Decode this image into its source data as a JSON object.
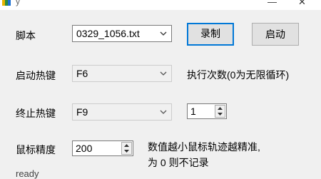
{
  "window": {
    "title": "y",
    "minimize_glyph": "—",
    "close_glyph": "✕"
  },
  "row_script": {
    "label": "脚本",
    "selected": "0329_1056.txt",
    "record_label": "录制",
    "start_label": "启动"
  },
  "row_start_hotkey": {
    "label": "启动热键",
    "selected": "F6",
    "repeat_hint": "执行次数(0为无限循环)"
  },
  "row_stop_hotkey": {
    "label": "终止热键",
    "selected": "F9",
    "repeat_count": "1"
  },
  "row_mouse_precision": {
    "label": "鼠标精度",
    "value": "200",
    "hint_line1": "数值越小鼠标轨迹越精准,",
    "hint_line2": "为 0 则不记录"
  },
  "status": {
    "text": "ready"
  },
  "icons": {
    "app": "app-logo-icon",
    "dropdown": "chevron-down-icon",
    "spin_up": "triangle-up-icon",
    "spin_down": "triangle-down-icon"
  },
  "colors": {
    "background": "#f0f0f0",
    "default_button_border": "#0078d7",
    "button_face": "#e1e1e1"
  }
}
